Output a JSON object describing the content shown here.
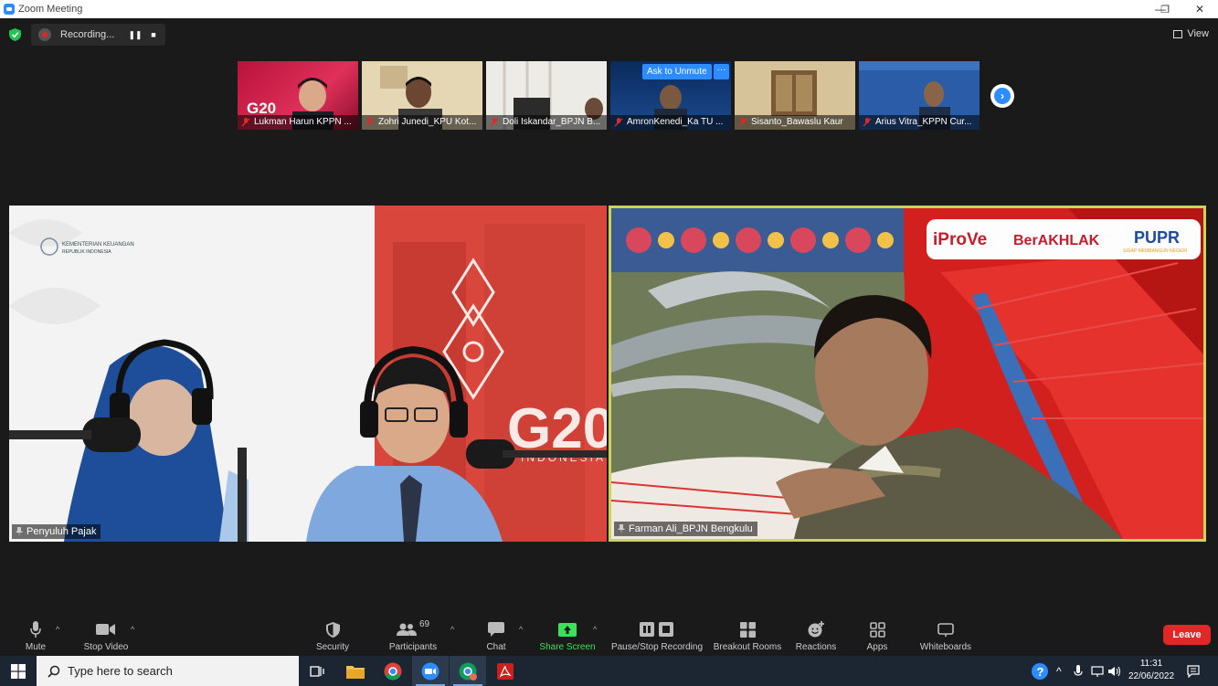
{
  "window": {
    "title": "Zoom Meeting",
    "controls": [
      "—",
      "❐",
      "✕"
    ]
  },
  "recording": {
    "label": "Recording..."
  },
  "view": {
    "label": "View"
  },
  "gallery": {
    "ask_to_unmute": "Ask to Unmute",
    "more": "···",
    "participants": [
      {
        "name": "Lukman Harun KPPN ..."
      },
      {
        "name": "Zohri Junedi_KPU Kot..."
      },
      {
        "name": "Doli Iskandar_BPJN B..."
      },
      {
        "name": "AmronKenedi_Ka TU ..."
      },
      {
        "name": "Sisanto_Bawaslu Kaur"
      },
      {
        "name": "Arius Vitra_KPPN Cur..."
      }
    ]
  },
  "videos": {
    "left": {
      "name": "Penyuluh Pajak",
      "logo_text": "KEMENTERIAN KEUANGAN",
      "logo_sub": "REPUBLIK INDONESIA",
      "banner": "G20",
      "banner_sub": "INDONESIA"
    },
    "right": {
      "name": "Farman Ali_BPJN Bengkulu",
      "brand1": "iProVe",
      "brand2": "BerAKHLAK",
      "brand3": "PUPR",
      "brand3_sub": "SIGAP MEMBANGUN NEGERI"
    }
  },
  "toolbar": {
    "mute": "Mute",
    "stop_video": "Stop Video",
    "security": "Security",
    "participants": "Participants",
    "participants_count": "69",
    "chat": "Chat",
    "share_screen": "Share Screen",
    "pause_stop_recording": "Pause/Stop Recording",
    "breakout_rooms": "Breakout Rooms",
    "reactions": "Reactions",
    "apps": "Apps",
    "whiteboards": "Whiteboards",
    "leave": "Leave"
  },
  "taskbar": {
    "search_placeholder": "Type here to search",
    "time": "11:31",
    "date": "22/06/2022"
  },
  "colors": {
    "zoom_blue": "#2d8cff",
    "leave_red": "#e02828",
    "share_green": "#3ce05b",
    "active_speaker": "#cbd35a"
  }
}
